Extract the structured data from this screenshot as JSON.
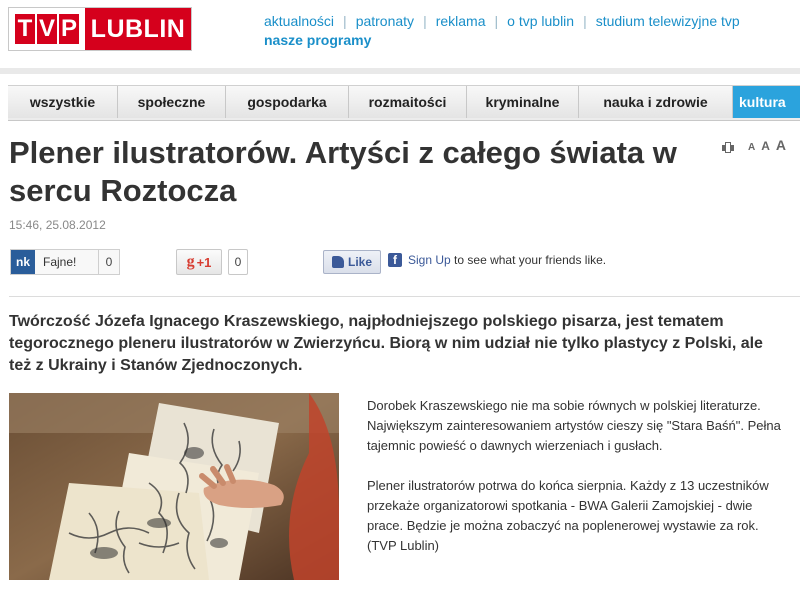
{
  "logo": {
    "tvp": [
      "T",
      "V",
      "P"
    ],
    "city": "LUBLIN"
  },
  "top_nav": {
    "links": [
      "aktualności",
      "patronaty",
      "reklama",
      "o tvp lublin",
      "studium telewizyjne tvp"
    ],
    "second_row": "nasze programy"
  },
  "categories": [
    "wszystkie",
    "społeczne",
    "gospodarka",
    "rozmaitości",
    "kryminalne",
    "nauka i zdrowie",
    "kultura"
  ],
  "active_category": "kultura",
  "article": {
    "title": "Plener ilustratorów. Artyści z całego świata w sercu Roztocza",
    "date": "15:46, 25.08.2012",
    "lead": "Twórczość Józefa Ignacego Kraszewskiego, najpłodniejszego polskiego pisarza, jest tematem tegorocznego pleneru ilustratorów w Zwierzyńcu. Biorą w nim udział nie tylko plastycy z Polski, ale też z Ukrainy i Stanów Zjednoczonych.",
    "paragraphs": [
      "Dorobek Kraszewskiego nie ma sobie równych w polskiej literaturze. Największym zainteresowaniem artystów cieszy się \"Stara Baśń\". Pełna tajemnic powieść o dawnych wierzeniach i gusłach.",
      "Plener ilustratorów potrwa do końca sierpnia. Każdy z 13 uczestników przekaże organizatorowi spotkania - BWA Galerii Zamojskiej - dwie prace. Będzie je można zobaczyć na poplenerowej wystawie za rok. (TVP Lublin)"
    ]
  },
  "tools": {
    "font_small": "A",
    "font_medium": "A",
    "font_large": "A"
  },
  "social": {
    "nk_logo": "nk",
    "nk_label": "Fajne!",
    "nk_count": "0",
    "gplus_g": "g",
    "gplus_label": "+1",
    "gplus_count": "0",
    "fb_like": "Like",
    "fb_icon": "f",
    "fb_signup": "Sign Up",
    "fb_text": "to see what your friends like."
  },
  "colors": {
    "brand_red": "#d5001c",
    "link_blue": "#1a8fc9",
    "active_tab": "#2ba3dd",
    "facebook": "#3b5998"
  }
}
